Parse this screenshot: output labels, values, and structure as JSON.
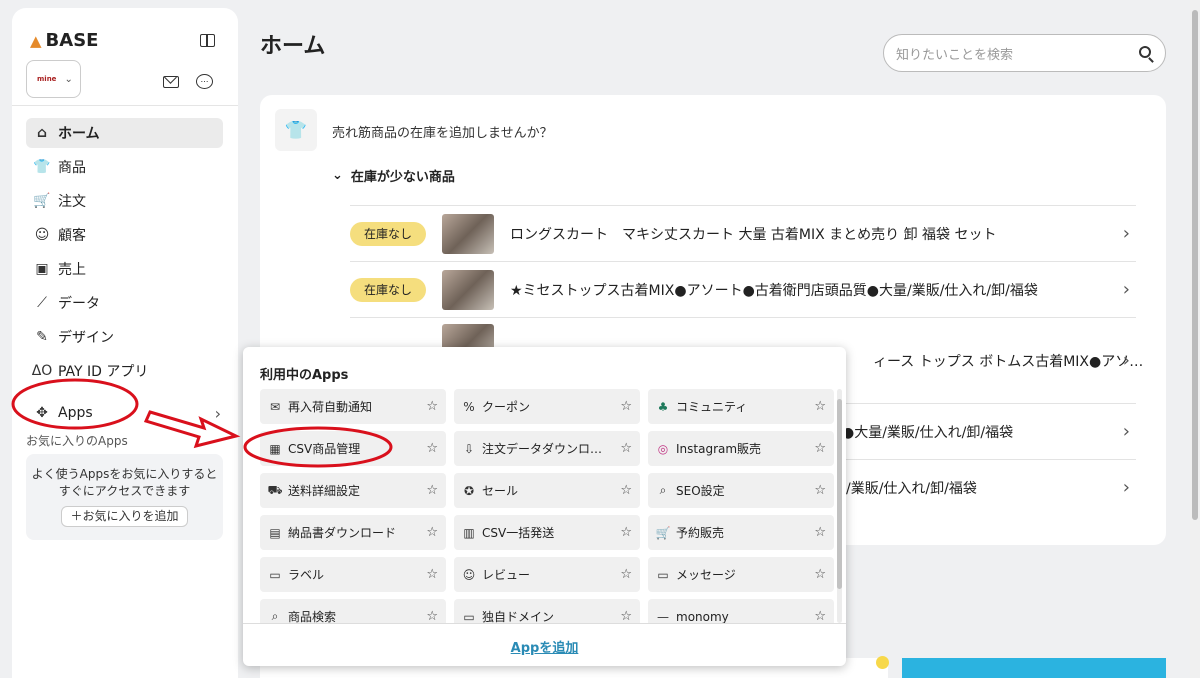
{
  "sidebar": {
    "brand": "BASE",
    "shop_logo": "mine",
    "nav": [
      {
        "label": "ホーム",
        "icon": "home-icon",
        "active": true
      },
      {
        "label": "商品",
        "icon": "tshirt-icon"
      },
      {
        "label": "注文",
        "icon": "cart-icon"
      },
      {
        "label": "顧客",
        "icon": "person-icon"
      },
      {
        "label": "売上",
        "icon": "wallet-icon"
      },
      {
        "label": "データ",
        "icon": "chart-icon"
      },
      {
        "label": "デザイン",
        "icon": "brush-icon"
      },
      {
        "label": "PAY ID アプリ",
        "icon": "payid-icon"
      }
    ],
    "apps_label": "Apps",
    "fav_title": "お気に入りのApps",
    "fav_desc_1": "よく使うAppsをお気に入りすると",
    "fav_desc_2": "すぐにアクセスできます",
    "fav_add": "＋お気に入りを追加"
  },
  "header": {
    "title": "ホーム",
    "search_placeholder": "知りたいことを検索"
  },
  "stock_card": {
    "message": "売れ筋商品の在庫を追加しませんか？",
    "section_title": "在庫が少ない商品",
    "items": [
      {
        "badge": "在庫なし",
        "name": "ロングスカート　マキシ丈スカート 大量 古着MIX まとめ売り 卸 福袋 セット"
      },
      {
        "badge": "在庫なし",
        "name": "★ミセストップス古着MIX●アソート●古着衛門店頭品質●大量/業販/仕入れ/卸/福袋"
      },
      {
        "badge": "",
        "name": "ィース トップス ボトムス古着MIX●アソ…"
      },
      {
        "badge": "",
        "name": "質●大量/業販/仕入れ/卸/福袋"
      },
      {
        "badge": "",
        "name": "/業販/仕入れ/卸/福袋"
      }
    ]
  },
  "apps_popup": {
    "title": "利用中のApps",
    "apps": [
      {
        "label": "再入荷自動通知",
        "icon": "mail-icon"
      },
      {
        "label": "クーポン",
        "icon": "coupon-icon"
      },
      {
        "label": "コミュニティ",
        "icon": "community-icon"
      },
      {
        "label": "CSV商品管理",
        "icon": "csv-icon"
      },
      {
        "label": "注文データダウンロ…",
        "icon": "download-icon"
      },
      {
        "label": "Instagram販売",
        "icon": "instagram-icon"
      },
      {
        "label": "送料詳細設定",
        "icon": "truck-icon"
      },
      {
        "label": "セール",
        "icon": "sale-icon"
      },
      {
        "label": "SEO設定",
        "icon": "seo-icon"
      },
      {
        "label": "納品書ダウンロード",
        "icon": "invoice-icon"
      },
      {
        "label": "CSV一括発送",
        "icon": "shipping-icon"
      },
      {
        "label": "予約販売",
        "icon": "reserve-cart-icon"
      },
      {
        "label": "ラベル",
        "icon": "label-icon"
      },
      {
        "label": "レビュー",
        "icon": "smile-icon"
      },
      {
        "label": "メッセージ",
        "icon": "message-icon"
      },
      {
        "label": "商品検索",
        "icon": "search-icon"
      },
      {
        "label": "独自ドメイン",
        "icon": "domain-icon"
      },
      {
        "label": "monomy",
        "icon": "monomy-icon"
      }
    ],
    "add_link": "Appを追加"
  },
  "colors": {
    "badge": "#f5de7e",
    "link": "#2a8bb5",
    "annotation": "#d9101c"
  }
}
